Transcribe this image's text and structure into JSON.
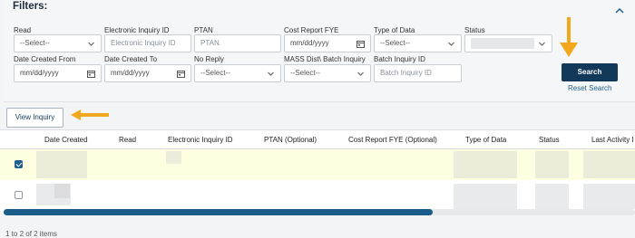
{
  "filters": {
    "title": "Filters:",
    "fields": {
      "read": {
        "label": "Read",
        "value": "--Select--"
      },
      "electronic_inquiry_id": {
        "label": "Electronic Inquiry ID",
        "placeholder": "Electronic Inquiry ID"
      },
      "ptan": {
        "label": "PTAN",
        "placeholder": "PTAN"
      },
      "cost_report_fye": {
        "label": "Cost Report FYE",
        "placeholder": "mm/dd/yyyy"
      },
      "type_of_data": {
        "label": "Type of Data",
        "value": "--Select--"
      },
      "status": {
        "label": "Status",
        "value": ""
      },
      "date_created_from": {
        "label": "Date Created From",
        "placeholder": "mm/dd/yyyy"
      },
      "date_created_to": {
        "label": "Date Created To",
        "placeholder": "mm/dd/yyyy"
      },
      "no_reply": {
        "label": "No Reply",
        "value": "--Select--"
      },
      "mass_dist_batch_inquiry": {
        "label": "MASS Dist\\ Batch Inquiry",
        "value": "--Select--"
      },
      "batch_inquiry_id": {
        "label": "Batch Inquiry ID",
        "placeholder": "Batch Inquiry ID"
      }
    },
    "search_label": "Search",
    "reset_label": "Reset Search"
  },
  "toolbar": {
    "view_inquiry_label": "View Inquiry"
  },
  "grid": {
    "columns": [
      "Date Created",
      "Read",
      "Electronic Inquiry ID",
      "PTAN (Optional)",
      "Cost Report FYE (Optional)",
      "Type of Data",
      "Status",
      "Last Activity I"
    ],
    "rows": [
      {
        "checked": true
      },
      {
        "checked": false
      }
    ],
    "scroll_fraction": 0.68
  },
  "pager": {
    "text": "1 to 2 of 2 items"
  },
  "colors": {
    "primary": "#12395a",
    "link": "#1d5f8f",
    "selected_row": "#fefee0",
    "annotation_arrow": "#f2a81d"
  }
}
